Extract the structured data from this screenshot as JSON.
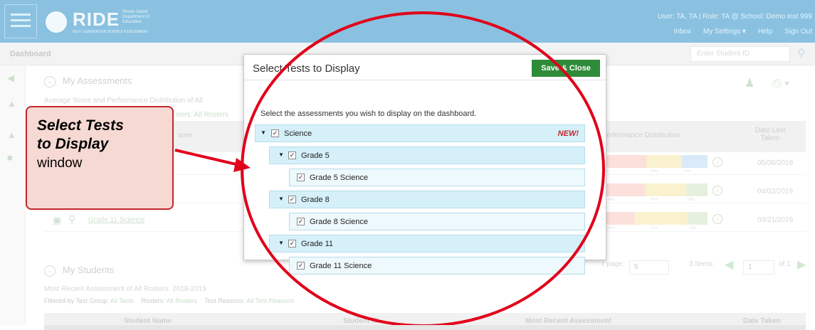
{
  "header": {
    "logo_text": "RIDE",
    "logo_small": "Rhode Island Department of Education",
    "logo_sub": "NEXT GENERATION SCIENCE ASSESSMENT",
    "user_line": "User: TA, TA  |  Role: TA @ School: Demo inst 999",
    "utilities": [
      "Inbox",
      "My Settings ▾",
      "Help",
      "Sign Out"
    ]
  },
  "subbar": {
    "title": "Dashboard",
    "student_placeholder": "Enter Student ID"
  },
  "assessments": {
    "title": "My Assessments",
    "subtitle": "Average Score and Performance Distribution of All",
    "filter_partial": "sters: All Rosters",
    "col_name": "ame",
    "col_perf": "erformance Distribution",
    "col_date": "Date Last Taken",
    "rows": [
      {
        "date": "05/08/2019",
        "pcts": [
          "1%",
          "44%",
          "22%"
        ]
      },
      {
        "date": "04/02/2019",
        "pcts": [
          "40%",
          "40%",
          "20%"
        ]
      },
      {
        "name": "Grade 11 Science",
        "date": "03/21/2019",
        "pcts": [
          "30%",
          "51%",
          "19%"
        ]
      }
    ],
    "pager_per_page": "r page:",
    "pager_count": "5",
    "pager_items": "3 Items:",
    "pager_page": "1",
    "pager_of": "of 1"
  },
  "students": {
    "title": "My Students",
    "subtitle": "Most Recent Assessment of All Rosters: 2018-2019",
    "filter": {
      "test_group_label": "Filtered by Test Group:",
      "test_group_value": "All Tests",
      "rosters_label": "Rosters:",
      "rosters_value": "All Rosters",
      "reasons_label": "Test Reasons:",
      "reasons_value": "All Test Reasons"
    },
    "cols": [
      "Student Name",
      "Student ID",
      "Most Recent Assessment",
      "Date Taken"
    ]
  },
  "modal": {
    "title": "Select Tests to Display",
    "save_label": "Save & Close",
    "instruction": "Select the assessments you wish to display on the dashboard.",
    "tree": {
      "root": "Science",
      "new_tag": "NEW!",
      "groups": [
        {
          "label": "Grade 5",
          "leaf": "Grade 5 Science"
        },
        {
          "label": "Grade 8",
          "leaf": "Grade 8 Science"
        },
        {
          "label": "Grade 11",
          "leaf": "Grade 11 Science"
        }
      ]
    }
  },
  "callout": {
    "line1": "Select Tests",
    "line2": "to Display",
    "line3": "window"
  },
  "colors": {
    "header_blue": "#2b8fc7",
    "save_green": "#2e8b3a",
    "annotation_red": "#e1001a",
    "row_blue": "#d6f0fa"
  }
}
